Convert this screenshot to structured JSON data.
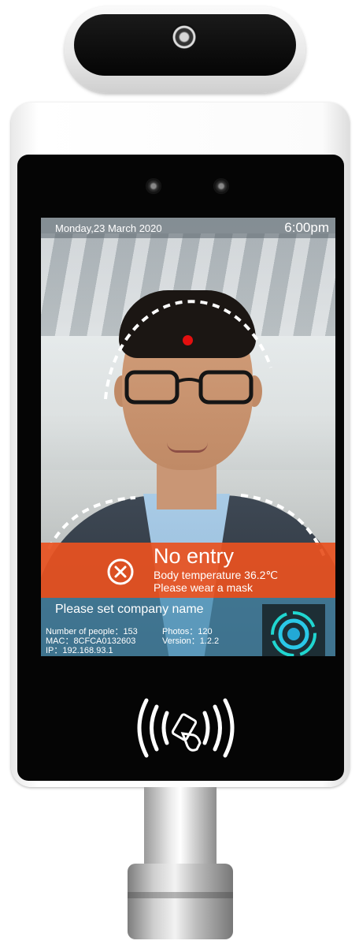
{
  "status_bar": {
    "date": "Monday,23 March 2020",
    "time": "6:00pm"
  },
  "alert": {
    "icon": "x-circle-icon",
    "title": "No entry",
    "temperature_text": "Body temperature 36.2℃",
    "mask_text": "Please wear a mask",
    "color": "#e85220"
  },
  "info_panel": {
    "company_prompt": "Please set company name",
    "people_count": "Number of people：153",
    "photos": "Photos：120",
    "mac": "MAC：8CFCA0132603",
    "version": "Version：1.2.2",
    "ip": "IP：192.168.93.1",
    "color": "#468caf"
  },
  "icons": [
    "camera-lens-icon",
    "infrared-sensor-icon",
    "temperature-dot-icon",
    "face-scan-icon",
    "nfc-card-icon"
  ]
}
